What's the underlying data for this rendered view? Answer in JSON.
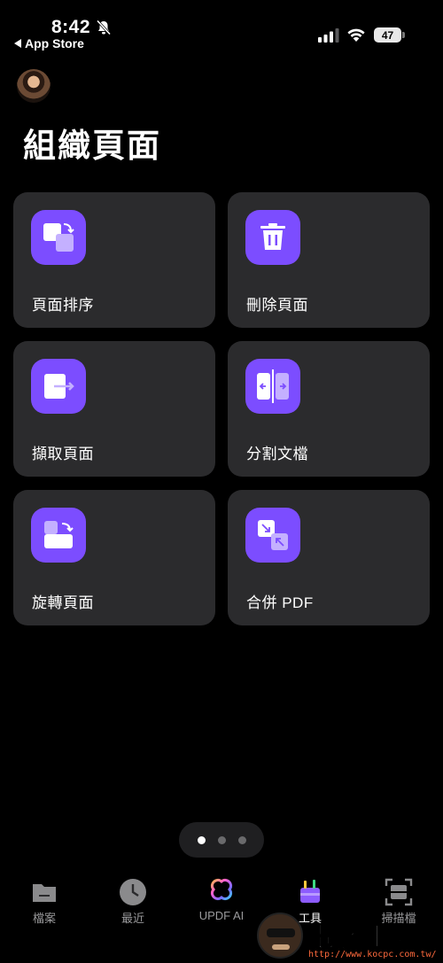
{
  "status_bar": {
    "time": "8:42",
    "back_label": "App Store",
    "battery": "47"
  },
  "header": {
    "title": "組織頁面"
  },
  "tools": [
    {
      "label": "頁面排序",
      "icon": "reorder-pages-icon"
    },
    {
      "label": "刪除頁面",
      "icon": "trash-icon"
    },
    {
      "label": "擷取頁面",
      "icon": "extract-page-icon"
    },
    {
      "label": "分割文檔",
      "icon": "split-document-icon"
    },
    {
      "label": "旋轉頁面",
      "icon": "rotate-page-icon"
    },
    {
      "label": "合併 PDF",
      "icon": "merge-pdf-icon"
    }
  ],
  "pager": {
    "pages": 3,
    "active": 1
  },
  "tabbar": {
    "items": [
      {
        "label": "檔案",
        "icon": "folder-icon"
      },
      {
        "label": "最近",
        "icon": "clock-icon"
      },
      {
        "label": "UPDF AI",
        "icon": "updf-ai-icon"
      },
      {
        "label": "工具",
        "icon": "toolbox-icon"
      },
      {
        "label": "掃描檔",
        "icon": "scan-icon"
      }
    ],
    "active": 3
  },
  "watermark": {
    "text": "電腦王阿達",
    "url": "http://www.kocpc.com.tw/"
  },
  "colors": {
    "background": "#000000",
    "card": "#2b2b2d",
    "accent": "#7c4dff",
    "inactive_text": "#9a9a9c"
  }
}
